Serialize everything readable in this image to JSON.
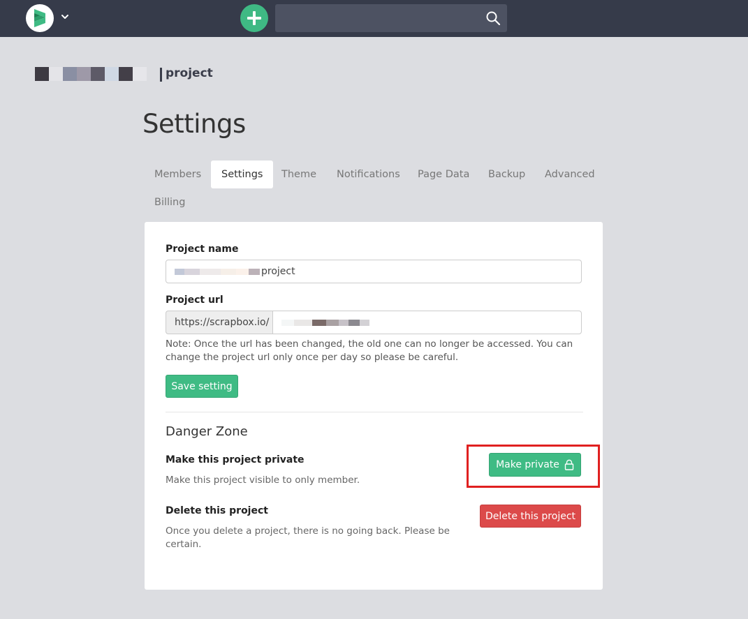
{
  "navbar": {
    "logo_icon": "scrapbox-logo-icon",
    "menu_icon": "chevron-down-icon",
    "add_icon": "plus-icon",
    "search": {
      "value": "",
      "placeholder": "",
      "icon": "search-icon"
    }
  },
  "project": {
    "name_suffix": "project"
  },
  "page": {
    "title": "Settings"
  },
  "tabs": [
    {
      "label": "Members",
      "active": false
    },
    {
      "label": "Settings",
      "active": true
    },
    {
      "label": "Theme",
      "active": false
    },
    {
      "label": "Notifications",
      "active": false
    },
    {
      "label": "Page Data",
      "active": false
    },
    {
      "label": "Backup",
      "active": false
    },
    {
      "label": "Advanced",
      "active": false
    },
    {
      "label": "Billing",
      "active": false
    }
  ],
  "form": {
    "project_name_label": "Project name",
    "project_name_value_visible": "project",
    "project_url_label": "Project url",
    "url_prefix": "https://scrapbox.io/",
    "note": "Note: Once the url has been changed, the old one can no longer be accessed. You can change the project url only once per day so please be careful.",
    "save_label": "Save setting"
  },
  "danger_zone": {
    "title": "Danger Zone",
    "private": {
      "heading": "Make this project private",
      "description": "Make this project visible to only member.",
      "button_label": "Make private",
      "button_icon": "lock-icon"
    },
    "delete": {
      "heading": "Delete this project",
      "description": "Once you delete a project, there is no going back. Please be certain.",
      "button_label": "Delete this project"
    }
  },
  "colors": {
    "navbar": "#363b4a",
    "accent_green": "#3fbb84",
    "danger_red": "#dc4a4a",
    "highlight": "#e02020",
    "background": "#dcdde1"
  }
}
